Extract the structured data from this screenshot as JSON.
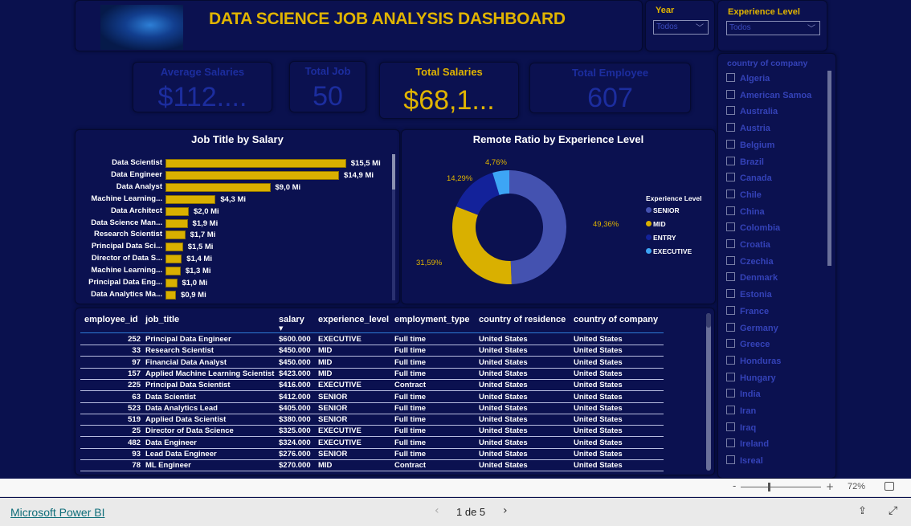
{
  "header": {
    "title": "DATA SCIENCE JOB ANALYSIS DASHBOARD",
    "logo": "ai-face-image"
  },
  "filters": {
    "year": {
      "label": "Year",
      "value": "Todos"
    },
    "experience": {
      "label": "Experience Level",
      "value": "Todos"
    }
  },
  "kpis": [
    {
      "label": "Average Salaries",
      "value": "$112...."
    },
    {
      "label": "Total Job",
      "value": "50"
    },
    {
      "label": "Total Salaries",
      "value": "$68,1..."
    },
    {
      "label": "Total Employee",
      "value": "607"
    }
  ],
  "chart_data": [
    {
      "type": "bar",
      "title": "Job Title by Salary",
      "orientation": "horizontal",
      "categories": [
        "Data Scientist",
        "Data Engineer",
        "Data Analyst",
        "Machine Learning...",
        "Data Architect",
        "Data Science Man...",
        "Research Scientist",
        "Principal Data Sci...",
        "Director of Data S...",
        "Machine Learning...",
        "Principal Data Eng...",
        "Data Analytics Ma..."
      ],
      "values": [
        15.5,
        14.9,
        9.0,
        4.3,
        2.0,
        1.9,
        1.7,
        1.5,
        1.4,
        1.3,
        1.0,
        0.9
      ],
      "labels": [
        "$15,5 Mi",
        "$14,9 Mi",
        "$9,0 Mi",
        "$4,3 Mi",
        "$2,0 Mi",
        "$1,9 Mi",
        "$1,7 Mi",
        "$1,5 Mi",
        "$1,4 Mi",
        "$1,3 Mi",
        "$1,0 Mi",
        "$0,9 Mi"
      ],
      "color": "#d9b000"
    },
    {
      "type": "pie",
      "donut": true,
      "title": "Remote Ratio by Experience Level",
      "legend_title": "Experience Level",
      "legend_placement": "right",
      "slices": [
        {
          "name": "SENIOR",
          "value": 49.36,
          "label": "49,36%",
          "color": "#4452b0"
        },
        {
          "name": "MID",
          "value": 31.59,
          "label": "31,59%",
          "color": "#d9b000"
        },
        {
          "name": "ENTRY",
          "value": 14.29,
          "label": "14,29%",
          "color": "#13229a"
        },
        {
          "name": "EXECUTIVE",
          "value": 4.76,
          "label": "4,76%",
          "color": "#3da5f5"
        }
      ]
    }
  ],
  "table": {
    "columns": [
      "employee_id",
      "job_title",
      "salary",
      "experience_level",
      "employment_type",
      "country of residence",
      "country of company"
    ],
    "sort_column": "salary",
    "rows": [
      [
        "252",
        "Principal Data Engineer",
        "$600.000",
        "EXECUTIVE",
        "Full time",
        "United States",
        "United States"
      ],
      [
        "33",
        "Research Scientist",
        "$450.000",
        "MID",
        "Full time",
        "United States",
        "United States"
      ],
      [
        "97",
        "Financial Data Analyst",
        "$450.000",
        "MID",
        "Full time",
        "United States",
        "United States"
      ],
      [
        "157",
        "Applied Machine Learning Scientist",
        "$423.000",
        "MID",
        "Full time",
        "United States",
        "United States"
      ],
      [
        "225",
        "Principal Data Scientist",
        "$416.000",
        "EXECUTIVE",
        "Contract",
        "United States",
        "United States"
      ],
      [
        "63",
        "Data Scientist",
        "$412.000",
        "SENIOR",
        "Full time",
        "United States",
        "United States"
      ],
      [
        "523",
        "Data Analytics Lead",
        "$405.000",
        "SENIOR",
        "Full time",
        "United States",
        "United States"
      ],
      [
        "519",
        "Applied Data Scientist",
        "$380.000",
        "SENIOR",
        "Full time",
        "United States",
        "United States"
      ],
      [
        "25",
        "Director of Data Science",
        "$325.000",
        "EXECUTIVE",
        "Full time",
        "United States",
        "United States"
      ],
      [
        "482",
        "Data Engineer",
        "$324.000",
        "EXECUTIVE",
        "Full time",
        "United States",
        "United States"
      ],
      [
        "93",
        "Lead Data Engineer",
        "$276.000",
        "SENIOR",
        "Full time",
        "United States",
        "United States"
      ],
      [
        "78",
        "ML Engineer",
        "$270.000",
        "MID",
        "Contract",
        "United States",
        "United States"
      ]
    ]
  },
  "country_slicer": {
    "title": "country of company",
    "items": [
      "Algeria",
      "American Samoa",
      "Australia",
      "Austria",
      "Belgium",
      "Brazil",
      "Canada",
      "Chile",
      "China",
      "Colombia",
      "Croatia",
      "Czechia",
      "Denmark",
      "Estonia",
      "France",
      "Germany",
      "Greece",
      "Honduras",
      "Hungary",
      "India",
      "Iran",
      "Iraq",
      "Ireland",
      "Isreal"
    ]
  },
  "footer": {
    "zoom": "72%",
    "brand": "Microsoft Power BI",
    "page": "1 de 5"
  }
}
